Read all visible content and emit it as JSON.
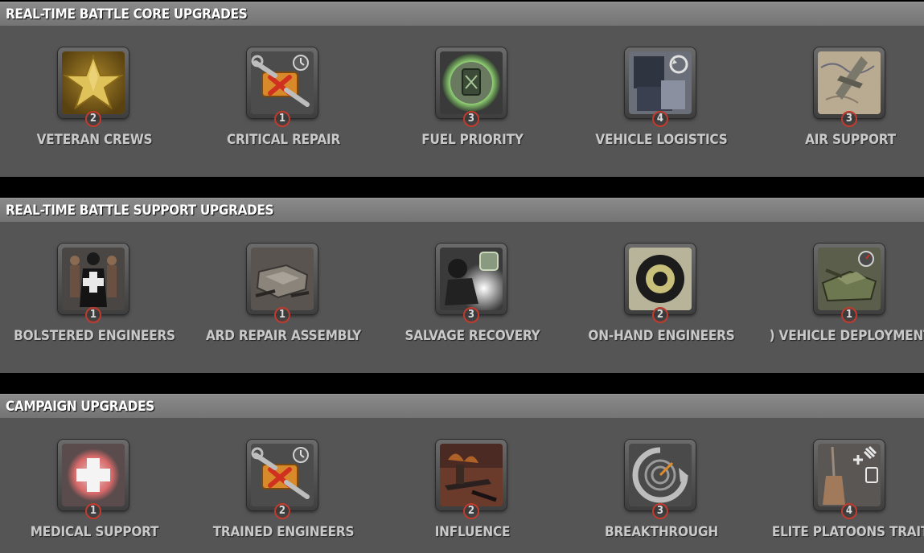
{
  "sections": [
    {
      "title": "REAL-TIME BATTLE CORE UPGRADES",
      "items": [
        {
          "label": "VETERAN CREWS",
          "level": "2",
          "icon": "gold-star-icon"
        },
        {
          "label": "CRITICAL REPAIR",
          "level": "1",
          "icon": "wrench-timer-icon"
        },
        {
          "label": "FUEL PRIORITY",
          "level": "3",
          "icon": "fuel-canister-icon"
        },
        {
          "label": "VEHICLE LOGISTICS",
          "level": "4",
          "icon": "vehicle-recycle-icon"
        },
        {
          "label": "AIR SUPPORT",
          "level": "3",
          "icon": "aircraft-map-icon"
        }
      ]
    },
    {
      "title": "REAL-TIME BATTLE SUPPORT UPGRADES",
      "items": [
        {
          "label": "BOLSTERED ENGINEERS",
          "level": "1",
          "icon": "engineer-soldiers-icon"
        },
        {
          "label": "ARD REPAIR ASSEMBLY",
          "level": "1",
          "icon": "repair-assembly-icon"
        },
        {
          "label": "SALVAGE RECOVERY",
          "level": "3",
          "icon": "salvage-welder-icon"
        },
        {
          "label": "ON-HAND ENGINEERS",
          "level": "2",
          "icon": "target-ring-icon"
        },
        {
          "label": ") VEHICLE DEPLOYMENT",
          "level": "1",
          "icon": "tank-deployment-icon"
        }
      ]
    },
    {
      "title": "CAMPAIGN UPGRADES",
      "items": [
        {
          "label": "MEDICAL SUPPORT",
          "level": "1",
          "icon": "medical-cross-icon"
        },
        {
          "label": "TRAINED ENGINEERS",
          "level": "2",
          "icon": "wrench-timer-icon"
        },
        {
          "label": "INFLUENCE",
          "level": "2",
          "icon": "battle-scene-icon"
        },
        {
          "label": "BREAKTHROUGH",
          "level": "3",
          "icon": "radar-arrow-icon"
        },
        {
          "label": "ELITE PLATOONS TRAIT",
          "level": "4",
          "icon": "elite-bayonet-icon"
        }
      ]
    }
  ],
  "colors": {
    "panel": "#555556",
    "header": "#7e7e7f",
    "level_ring": "#c23a2e",
    "label": "#c9c9c9"
  }
}
